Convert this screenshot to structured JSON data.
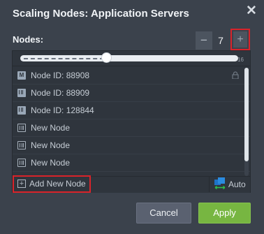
{
  "dialog": {
    "title": "Scaling Nodes: Application Servers",
    "close_icon": "close-icon"
  },
  "nodes": {
    "label": "Nodes:",
    "count": "7",
    "minus_label": "−",
    "plus_label": "+",
    "slider_value": 7,
    "slider_max": "16"
  },
  "node_list": {
    "items": [
      {
        "label": "Node ID: 88908",
        "icon": "master-node-icon",
        "locked": true
      },
      {
        "label": "Node ID: 88909",
        "icon": "node-icon"
      },
      {
        "label": "Node ID: 128844",
        "icon": "node-icon"
      },
      {
        "label": "New Node",
        "icon": "new-node-icon"
      },
      {
        "label": "New Node",
        "icon": "new-node-icon"
      },
      {
        "label": "New Node",
        "icon": "new-node-icon"
      }
    ],
    "master_badge": "M",
    "add_label": "Add New Node",
    "add_icon_glyph": "+",
    "auto_label": "Auto"
  },
  "actions": {
    "cancel_label": "Cancel",
    "apply_label": "Apply"
  },
  "colors": {
    "background": "#3b424c",
    "panel": "#2f353d",
    "highlight": "#d9232a",
    "apply": "#77b641",
    "cancel": "#5a6170"
  }
}
